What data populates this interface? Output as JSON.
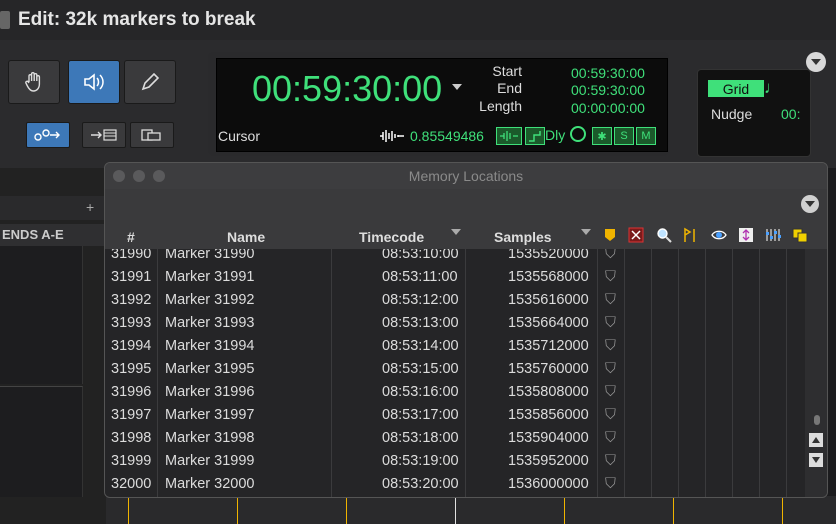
{
  "window": {
    "title": "Edit: 32k markers to break"
  },
  "counter": {
    "main": "00:59:30:00",
    "labels": {
      "start": "Start",
      "end": "End",
      "length": "Length"
    },
    "values": {
      "start": "00:59:30:00",
      "end": "00:59:30:00",
      "length": "00:00:00:00"
    },
    "cursor_label": "Cursor",
    "cursor_value": "0.85549486",
    "dly_label": "Dly",
    "s_label": "S",
    "m_label": "M"
  },
  "grid": {
    "label": "Grid",
    "nudge_label": "Nudge",
    "nudge_value": "00:"
  },
  "left_panel": {
    "sends_header": "ENDS A-E"
  },
  "memory_locations": {
    "title": "Memory Locations",
    "columns": {
      "num": "#",
      "name": "Name",
      "timecode": "Timecode",
      "samples": "Samples"
    },
    "rows": [
      {
        "num": "31990",
        "name": "Marker 31990",
        "timecode": "08:53:10:00",
        "samples": "1535520000"
      },
      {
        "num": "31991",
        "name": "Marker 31991",
        "timecode": "08:53:11:00",
        "samples": "1535568000"
      },
      {
        "num": "31992",
        "name": "Marker 31992",
        "timecode": "08:53:12:00",
        "samples": "1535616000"
      },
      {
        "num": "31993",
        "name": "Marker 31993",
        "timecode": "08:53:13:00",
        "samples": "1535664000"
      },
      {
        "num": "31994",
        "name": "Marker 31994",
        "timecode": "08:53:14:00",
        "samples": "1535712000"
      },
      {
        "num": "31995",
        "name": "Marker 31995",
        "timecode": "08:53:15:00",
        "samples": "1535760000"
      },
      {
        "num": "31996",
        "name": "Marker 31996",
        "timecode": "08:53:16:00",
        "samples": "1535808000"
      },
      {
        "num": "31997",
        "name": "Marker 31997",
        "timecode": "08:53:17:00",
        "samples": "1535856000"
      },
      {
        "num": "31998",
        "name": "Marker 31998",
        "timecode": "08:53:18:00",
        "samples": "1535904000"
      },
      {
        "num": "31999",
        "name": "Marker 31999",
        "timecode": "08:53:19:00",
        "samples": "1535952000"
      },
      {
        "num": "32000",
        "name": "Marker 32000",
        "timecode": "08:53:20:00",
        "samples": "1536000000"
      }
    ]
  },
  "colors": {
    "counter_green": "#3fe07a",
    "active_blue": "#3d78b8",
    "marker_yellow": "#f0b400"
  }
}
